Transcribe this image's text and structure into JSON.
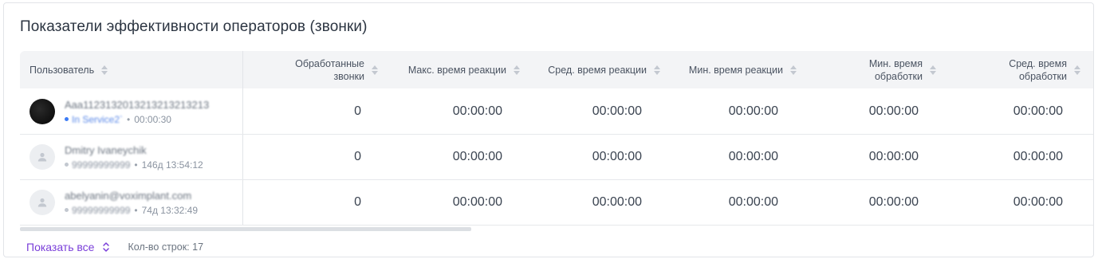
{
  "title": "Показатели эффективности операторов (звонки)",
  "columns": [
    {
      "line1": "Пользователь",
      "line2": ""
    },
    {
      "line1": "Обработанные",
      "line2": "звонки"
    },
    {
      "line1": "Макс. время реакции",
      "line2": ""
    },
    {
      "line1": "Сред. время реакции",
      "line2": ""
    },
    {
      "line1": "Мин. время реакции",
      "line2": ""
    },
    {
      "line1": "Мин. время",
      "line2": "обработки"
    },
    {
      "line1": "Сред. время",
      "line2": "обработки"
    }
  ],
  "rows": [
    {
      "name": "Aaa1123132013213213213213",
      "status": "In Service2`",
      "status_color": "#3d7cf5",
      "time": "00:00:30",
      "handled": "0",
      "max_reaction": "00:00:00",
      "avg_reaction": "00:00:00",
      "min_reaction": "00:00:00",
      "min_processing": "00:00:00",
      "avg_processing": "00:00:00"
    },
    {
      "name": "Dmitry Ivaneychik",
      "status": "99999999999",
      "status_color": "#c3c8d0",
      "time": "146д 13:54:12",
      "handled": "0",
      "max_reaction": "00:00:00",
      "avg_reaction": "00:00:00",
      "min_reaction": "00:00:00",
      "min_processing": "00:00:00",
      "avg_processing": "00:00:00"
    },
    {
      "name": "abelyanin@voximplant.com",
      "status": "99999999999",
      "status_color": "#c3c8d0",
      "time": "74д 13:32:49",
      "handled": "0",
      "max_reaction": "00:00:00",
      "avg_reaction": "00:00:00",
      "min_reaction": "00:00:00",
      "min_processing": "00:00:00",
      "avg_processing": "00:00:00"
    }
  ],
  "footer": {
    "show_all": "Показать все",
    "row_count": "Кол-во строк: 17"
  },
  "colors": {
    "accent": "#7a3fd9",
    "online": "#3d7cf5",
    "header_bg": "#f3f4f6"
  },
  "icons": {
    "sort": "sort-arrows-icon",
    "avatar_placeholder": "user-icon",
    "expand": "chevron-up-down-icon"
  }
}
